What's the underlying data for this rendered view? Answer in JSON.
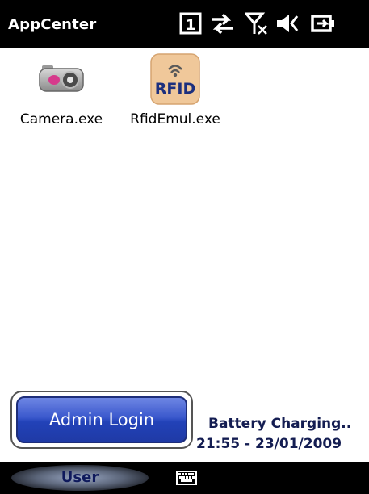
{
  "titlebar": {
    "app_title": "AppCenter",
    "status_icons": [
      "notification-1-icon",
      "data-connection-icon",
      "no-signal-icon",
      "volume-muted-icon",
      "battery-charging-icon"
    ]
  },
  "desktop": {
    "items": [
      {
        "label": "Camera.exe",
        "icon": "camera-icon"
      },
      {
        "label": "RfidEmul.exe",
        "icon": "rfid-icon",
        "icon_text": "RFID"
      }
    ]
  },
  "admin": {
    "button_label": "Admin Login"
  },
  "status": {
    "battery": "Battery Charging..",
    "datetime": "21:55 - 23/01/2009"
  },
  "bottombar": {
    "left_softkey": "User",
    "keyboard": "keyboard-icon"
  },
  "colors": {
    "bar_bg": "#000000",
    "button_blue": "#2242b8",
    "status_text": "#141d52"
  }
}
